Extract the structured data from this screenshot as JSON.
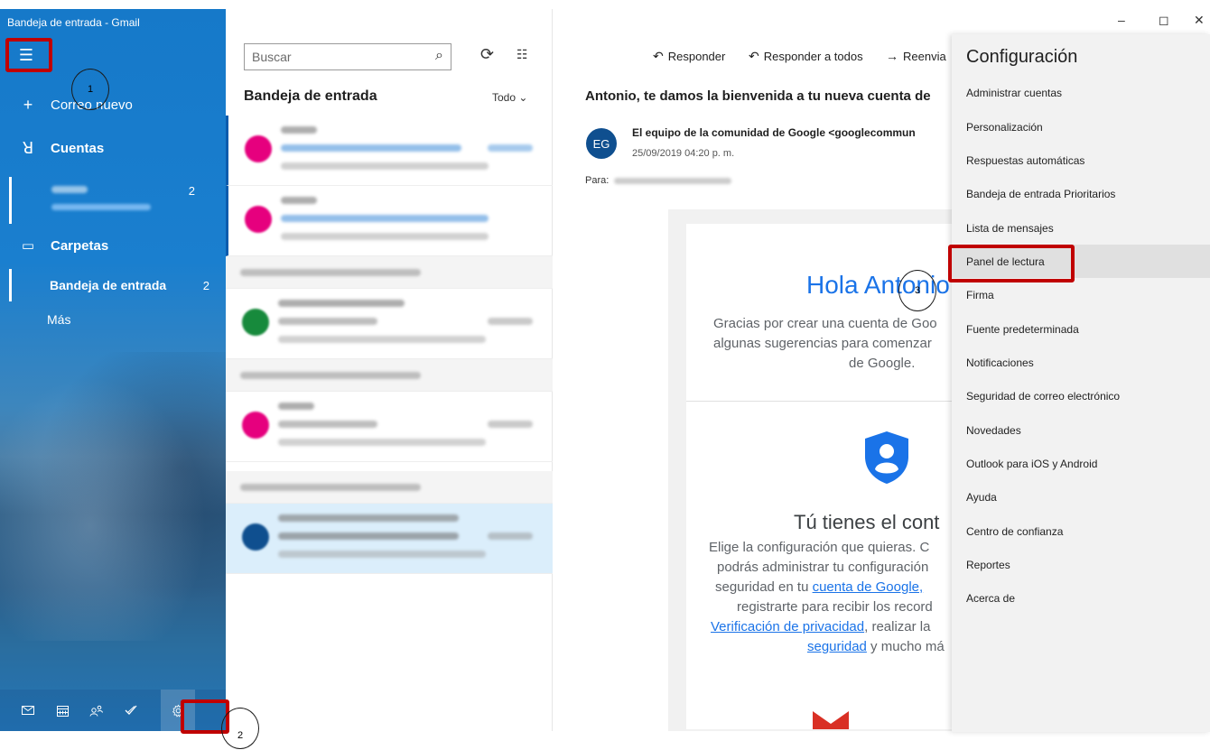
{
  "window": {
    "title": "Bandeja de entrada - Gmail",
    "minimize": "–",
    "maximize": "◻",
    "close": "✕"
  },
  "nav": {
    "menu_icon": "☰",
    "new_mail": {
      "icon": "+",
      "label": "Correo nuevo"
    },
    "accounts": {
      "icon": "ꓤ",
      "label": "Cuentas",
      "account_count": "2"
    },
    "folders": {
      "icon": "▭",
      "label": "Carpetas"
    },
    "folder_items": [
      {
        "label": "Bandeja de entrada",
        "count": "2"
      },
      {
        "label": "Más",
        "count": ""
      }
    ],
    "bottom_icons": [
      "mail-icon",
      "calendar-icon",
      "people-icon",
      "todo-icon",
      "settings-icon"
    ]
  },
  "list": {
    "search_placeholder": "Buscar",
    "search_icon": "⌕",
    "sync_icon": "⟳",
    "select_icon": "☷",
    "title": "Bandeja de entrada",
    "filter_label": "Todo",
    "filter_chevron": "⌄",
    "avatar_colors": [
      "#e6007e",
      "#e6007e",
      "#178a3c",
      "#e6007e",
      "#0f4f8f"
    ]
  },
  "reading": {
    "toolbar": [
      {
        "icon": "↶",
        "label": "Responder"
      },
      {
        "icon": "↶",
        "label": "Responder a todos"
      },
      {
        "icon": "→",
        "label": "Reenvia"
      }
    ],
    "subject": "Antonio, te damos la bienvenida a tu nueva cuenta de",
    "avatar_initials": "EG",
    "sender": "El equipo de la comunidad de Google <googlecommun",
    "date": "25/09/2019 04:20 p. m.",
    "to_label": "Para:",
    "hola": "Hola Antonio",
    "gracias": [
      "Gracias por crear una cuenta de Goo",
      "algunas sugerencias para comenzar",
      "de Google."
    ],
    "tienes": "Tú tienes el cont",
    "elige": {
      "l1": "Elige la configuración que quieras. C",
      "l2": "podrás administrar tu configuración",
      "l3a": "seguridad en tu ",
      "l3link": "cuenta de Google,",
      "l4": "registrarte para recibir los record",
      "l5link": "Verificación de privacidad",
      "l5b": ", realizar la",
      "l6link": "seguridad",
      "l6b": " y mucho má"
    }
  },
  "settings": {
    "title": "Configuración",
    "items": [
      "Administrar cuentas",
      "Personalización",
      "Respuestas automáticas",
      "Bandeja de entrada Prioritarios",
      "Lista de mensajes",
      "Panel de lectura",
      "Firma",
      "Fuente predeterminada",
      "Notificaciones",
      "Seguridad de correo electrónico",
      "Novedades",
      "Outlook para iOS y Android",
      "Ayuda",
      "Centro de confianza",
      "Reportes",
      "Acerca de"
    ],
    "highlighted_item": "Panel de lectura"
  },
  "annotations": {
    "step1": "1",
    "step2": "2",
    "step3": "3",
    "box_color": "#c00000"
  }
}
